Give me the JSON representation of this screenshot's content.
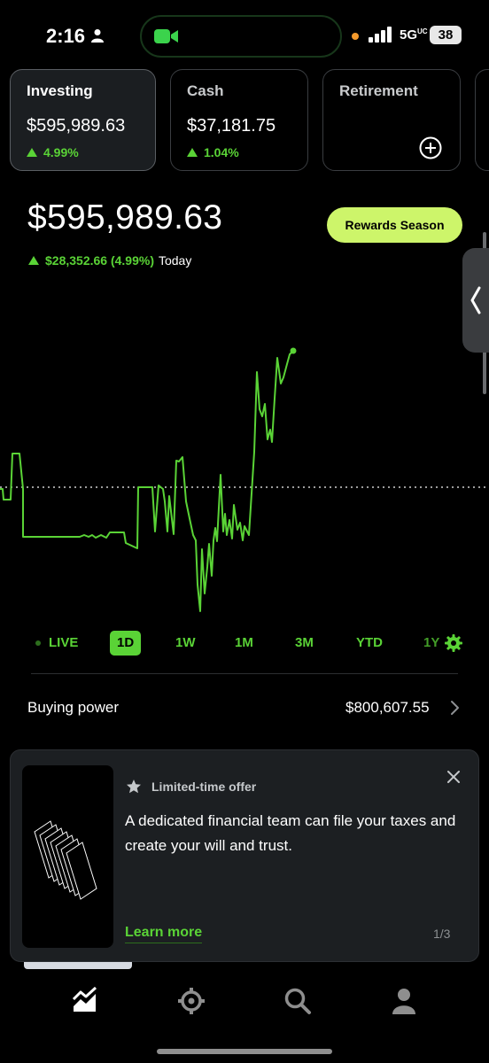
{
  "status_bar": {
    "time": "2:16",
    "network": "5G",
    "network_suffix": "UC",
    "battery": "38"
  },
  "accounts": [
    {
      "title": "Investing",
      "value": "$595,989.63",
      "change": "4.99%",
      "active": true
    },
    {
      "title": "Cash",
      "value": "$37,181.75",
      "change": "1.04%",
      "active": false
    },
    {
      "title": "Retirement",
      "value": "",
      "change": "",
      "active": false
    }
  ],
  "portfolio": {
    "value": "$595,989.63",
    "change_value": "$28,352.66 (4.99%)",
    "change_label": "Today",
    "rewards_label": "Rewards Season"
  },
  "chart": {
    "line_color": "#5ad336",
    "direction": "up"
  },
  "ranges": {
    "live": "LIVE",
    "items": [
      "1D",
      "1W",
      "1M",
      "3M",
      "YTD",
      "1Y"
    ],
    "selected": "1D"
  },
  "buying_power": {
    "label": "Buying power",
    "value": "$800,607.55"
  },
  "offer": {
    "tag": "Limited-time offer",
    "text": "A dedicated financial team can file your taxes and create your will and trust.",
    "cta": "Learn more",
    "pager": "1/3"
  },
  "nav": {
    "icons": [
      "chart-icon",
      "crypto-icon",
      "search-icon",
      "account-icon"
    ]
  },
  "colors": {
    "accent_green": "#5ad336",
    "rewards": "#cdf56a",
    "background": "#000000"
  }
}
